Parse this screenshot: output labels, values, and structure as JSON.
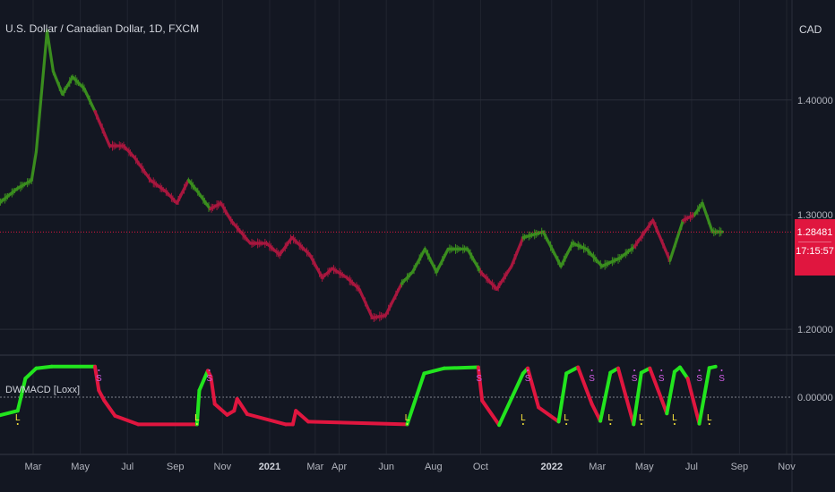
{
  "header": {
    "title": "U.S. Dollar / Canadian Dollar, 1D, FXCM",
    "currency": "CAD"
  },
  "last_price": {
    "value": "1.28481",
    "countdown": "17:15:57"
  },
  "indicator": {
    "title": "DWMACD [Loxx]"
  },
  "colors": {
    "background": "#131722",
    "bull": "#3a8d1e",
    "bear": "#a8173e",
    "ind_up": "#22e51e",
    "ind_down": "#e0163f",
    "long_marker": "#ffeb3b",
    "short_marker": "#d05ce3",
    "price_line": "#e0163f",
    "grid": "#2a2e39"
  },
  "chart_data": [
    {
      "type": "line",
      "title": "U.S. Dollar / Canadian Dollar, 1D, FXCM",
      "y_axis": {
        "ticks": [
          "1.40000",
          "1.30000",
          "1.20000"
        ],
        "ylim": [
          1.179,
          1.481
        ]
      },
      "x_axis": {
        "ticks": [
          "Mar",
          "May",
          "Jul",
          "Sep",
          "Nov",
          "2021",
          "Mar",
          "Apr",
          "Jun",
          "Aug",
          "Oct",
          "2022",
          "Mar",
          "May",
          "Jul",
          "Sep",
          "Nov"
        ],
        "tick_bold": [
          false,
          false,
          false,
          false,
          false,
          true,
          false,
          false,
          false,
          false,
          false,
          true,
          false,
          false,
          false,
          false,
          false
        ],
        "tick_dates": [
          "2020-03-01",
          "2020-05-01",
          "2020-07-01",
          "2020-09-01",
          "2020-11-01",
          "2021-01-01",
          "2021-03-01",
          "2021-04-01",
          "2021-06-01",
          "2021-08-01",
          "2021-10-01",
          "2022-01-01",
          "2022-03-01",
          "2022-05-01",
          "2022-07-01",
          "2022-09-01",
          "2022-11-01"
        ]
      },
      "grid": true,
      "last_price": 1.28481,
      "series": [
        {
          "x": [
            "2020-01-15",
            "2020-02-10",
            "2020-02-28",
            "2020-03-05",
            "2020-03-19",
            "2020-03-27",
            "2020-04-08",
            "2020-04-21",
            "2020-05-06",
            "2020-05-20",
            "2020-06-08",
            "2020-06-26",
            "2020-07-10",
            "2020-07-31",
            "2020-08-20",
            "2020-09-03",
            "2020-09-18",
            "2020-09-30",
            "2020-10-16",
            "2020-10-30",
            "2020-11-12",
            "2020-12-07",
            "2020-12-28",
            "2021-01-14",
            "2021-01-30",
            "2021-02-22",
            "2021-03-10",
            "2021-03-23",
            "2021-04-11",
            "2021-04-27",
            "2021-05-14",
            "2021-05-31",
            "2021-06-21",
            "2021-07-05",
            "2021-07-21",
            "2021-08-05",
            "2021-08-20",
            "2021-09-14",
            "2021-10-01",
            "2021-10-22",
            "2021-11-10",
            "2021-11-25",
            "2021-12-21",
            "2022-01-13",
            "2022-01-28",
            "2022-02-15",
            "2022-03-07",
            "2022-03-30",
            "2022-04-18",
            "2022-05-12",
            "2022-06-03",
            "2022-06-20",
            "2022-07-05",
            "2022-07-15",
            "2022-07-28",
            "2022-08-10"
          ],
          "values": [
            1.309,
            1.323,
            1.33,
            1.355,
            1.46,
            1.425,
            1.405,
            1.42,
            1.41,
            1.39,
            1.36,
            1.36,
            1.35,
            1.33,
            1.32,
            1.31,
            1.33,
            1.32,
            1.305,
            1.31,
            1.295,
            1.275,
            1.275,
            1.265,
            1.28,
            1.265,
            1.245,
            1.253,
            1.245,
            1.235,
            1.21,
            1.212,
            1.24,
            1.25,
            1.27,
            1.25,
            1.27,
            1.27,
            1.25,
            1.235,
            1.255,
            1.28,
            1.285,
            1.255,
            1.275,
            1.27,
            1.255,
            1.262,
            1.272,
            1.295,
            1.26,
            1.295,
            1.3,
            1.31,
            1.285,
            1.285
          ],
          "trend": [
            "up",
            "up",
            "up",
            "up",
            "up",
            "up",
            "up",
            "up",
            "up",
            "down",
            "down",
            "down",
            "down",
            "down",
            "down",
            "down",
            "up",
            "up",
            "down",
            "down",
            "down",
            "down",
            "down",
            "down",
            "down",
            "down",
            "down",
            "down",
            "down",
            "down",
            "down",
            "down",
            "up",
            "up",
            "up",
            "up",
            "up",
            "up",
            "down",
            "down",
            "down",
            "up",
            "up",
            "up",
            "up",
            "up",
            "up",
            "up",
            "down",
            "down",
            "up",
            "down",
            "up",
            "up",
            "up",
            "up"
          ]
        }
      ]
    },
    {
      "type": "line",
      "title": "DWMACD [Loxx]",
      "y_axis": {
        "ticks": [
          "0.00000"
        ],
        "ylim": [
          -1,
          1
        ]
      },
      "zero_line": true,
      "series": [
        {
          "x": [
            "2020-01-15",
            "2020-02-10",
            "2020-02-20",
            "2020-03-05",
            "2020-03-25",
            "2020-05-20",
            "2020-05-25",
            "2020-06-01",
            "2020-06-15",
            "2020-07-15",
            "2020-09-29",
            "2020-10-02",
            "2020-10-13",
            "2020-10-17",
            "2020-10-22",
            "2020-11-07",
            "2020-11-16",
            "2020-11-20",
            "2020-12-03",
            "2021-01-22",
            "2021-01-31",
            "2021-02-04",
            "2021-02-20",
            "2021-06-28",
            "2021-07-20",
            "2021-08-15",
            "2021-09-28",
            "2021-10-03",
            "2021-10-25",
            "2021-11-25",
            "2021-12-01",
            "2021-12-15",
            "2022-01-10",
            "2022-01-20",
            "2022-02-04",
            "2022-02-22",
            "2022-03-05",
            "2022-03-18",
            "2022-03-28",
            "2022-04-17",
            "2022-04-27",
            "2022-05-08",
            "2022-05-23",
            "2022-05-30",
            "2022-06-09",
            "2022-06-16",
            "2022-06-26",
            "2022-07-11",
            "2022-07-24",
            "2022-08-01"
          ],
          "values": [
            -0.55,
            -0.4,
            0.55,
            0.85,
            0.9,
            0.9,
            0.2,
            -0.1,
            -0.55,
            -0.8,
            -0.8,
            0.2,
            0.78,
            0.6,
            -0.2,
            -0.52,
            -0.4,
            -0.05,
            -0.5,
            -0.8,
            -0.8,
            -0.4,
            -0.72,
            -0.8,
            0.7,
            0.85,
            0.88,
            -0.1,
            -0.82,
            0.7,
            0.85,
            -0.3,
            -0.72,
            0.7,
            0.88,
            -0.2,
            -0.7,
            0.72,
            0.85,
            -0.8,
            0.72,
            0.85,
            -0.05,
            -0.48,
            0.75,
            0.88,
            0.55,
            -0.78,
            0.86,
            0.9
          ],
          "direction": [
            "down",
            "up",
            "up",
            "up",
            "up",
            "up",
            "down",
            "down",
            "down",
            "down",
            "down",
            "up",
            "up",
            "down",
            "down",
            "down",
            "down",
            "down",
            "down",
            "down",
            "down",
            "down",
            "down",
            "down",
            "up",
            "up",
            "up",
            "down",
            "down",
            "up",
            "up",
            "down",
            "down",
            "up",
            "up",
            "down",
            "down",
            "up",
            "up",
            "down",
            "up",
            "up",
            "down",
            "down",
            "up",
            "up",
            "up",
            "down",
            "up",
            "up"
          ]
        }
      ],
      "signals": [
        {
          "label": "L",
          "x": "2020-02-10"
        },
        {
          "label": "S",
          "x": "2020-05-25"
        },
        {
          "label": "L",
          "x": "2020-09-29"
        },
        {
          "label": "S",
          "x": "2020-10-15"
        },
        {
          "label": "L",
          "x": "2021-06-28"
        },
        {
          "label": "S",
          "x": "2021-09-29"
        },
        {
          "label": "L",
          "x": "2021-11-25"
        },
        {
          "label": "S",
          "x": "2021-12-01"
        },
        {
          "label": "L",
          "x": "2022-01-20"
        },
        {
          "label": "S",
          "x": "2022-02-22"
        },
        {
          "label": "L",
          "x": "2022-03-18"
        },
        {
          "label": "S",
          "x": "2022-04-18"
        },
        {
          "label": "L",
          "x": "2022-04-27"
        },
        {
          "label": "S",
          "x": "2022-05-23"
        },
        {
          "label": "L",
          "x": "2022-06-09"
        },
        {
          "label": "S",
          "x": "2022-07-11"
        },
        {
          "label": "L",
          "x": "2022-07-24"
        },
        {
          "label": "S",
          "x": "2022-08-09"
        }
      ]
    }
  ]
}
